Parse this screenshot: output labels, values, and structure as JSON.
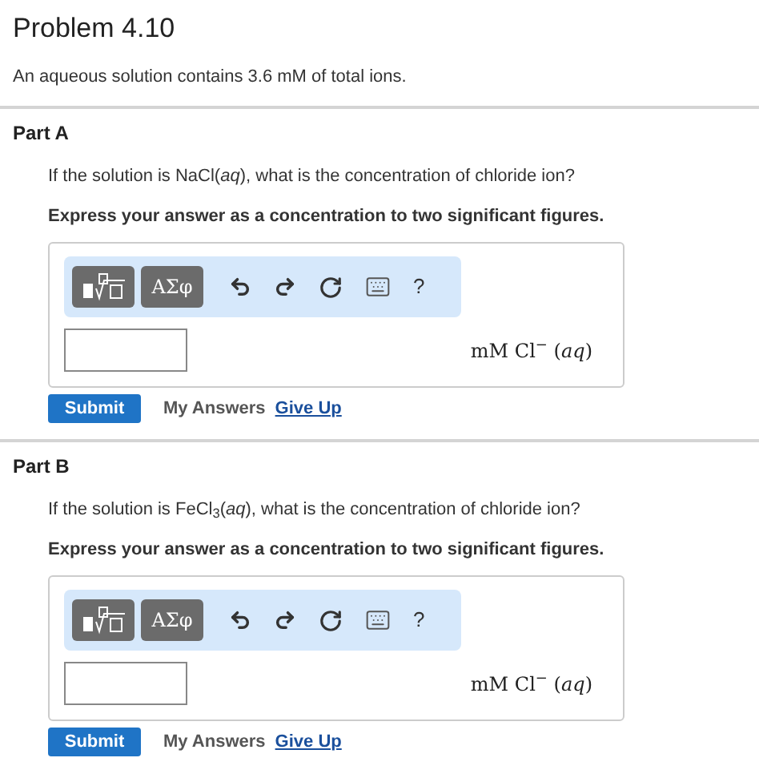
{
  "problem": {
    "title": "Problem 4.10",
    "intro": "An aqueous solution contains 3.6 mM of total ions."
  },
  "parts": [
    {
      "title": "Part A",
      "question": "If the solution is NaCl(*aq*), what is the concentration of chloride ion?",
      "instruction": "Express your answer as a concentration to two significant figures.",
      "symbols_label": "ΑΣφ",
      "help_label": "?",
      "unit": "mM Cl$^{−}$ (*aq*)",
      "submit": "Submit",
      "my_answers": "My Answers",
      "give_up": "Give Up"
    },
    {
      "title": "Part B",
      "question": "If the solution is FeCl$_{3}$(*aq*), what is the concentration of chloride ion?",
      "instruction": "Express your answer as a concentration to two significant figures.",
      "symbols_label": "ΑΣφ",
      "help_label": "?",
      "unit": "mM Cl$^{−}$ (*aq*)",
      "submit": "Submit",
      "my_answers": "My Answers",
      "give_up": "Give Up"
    }
  ]
}
